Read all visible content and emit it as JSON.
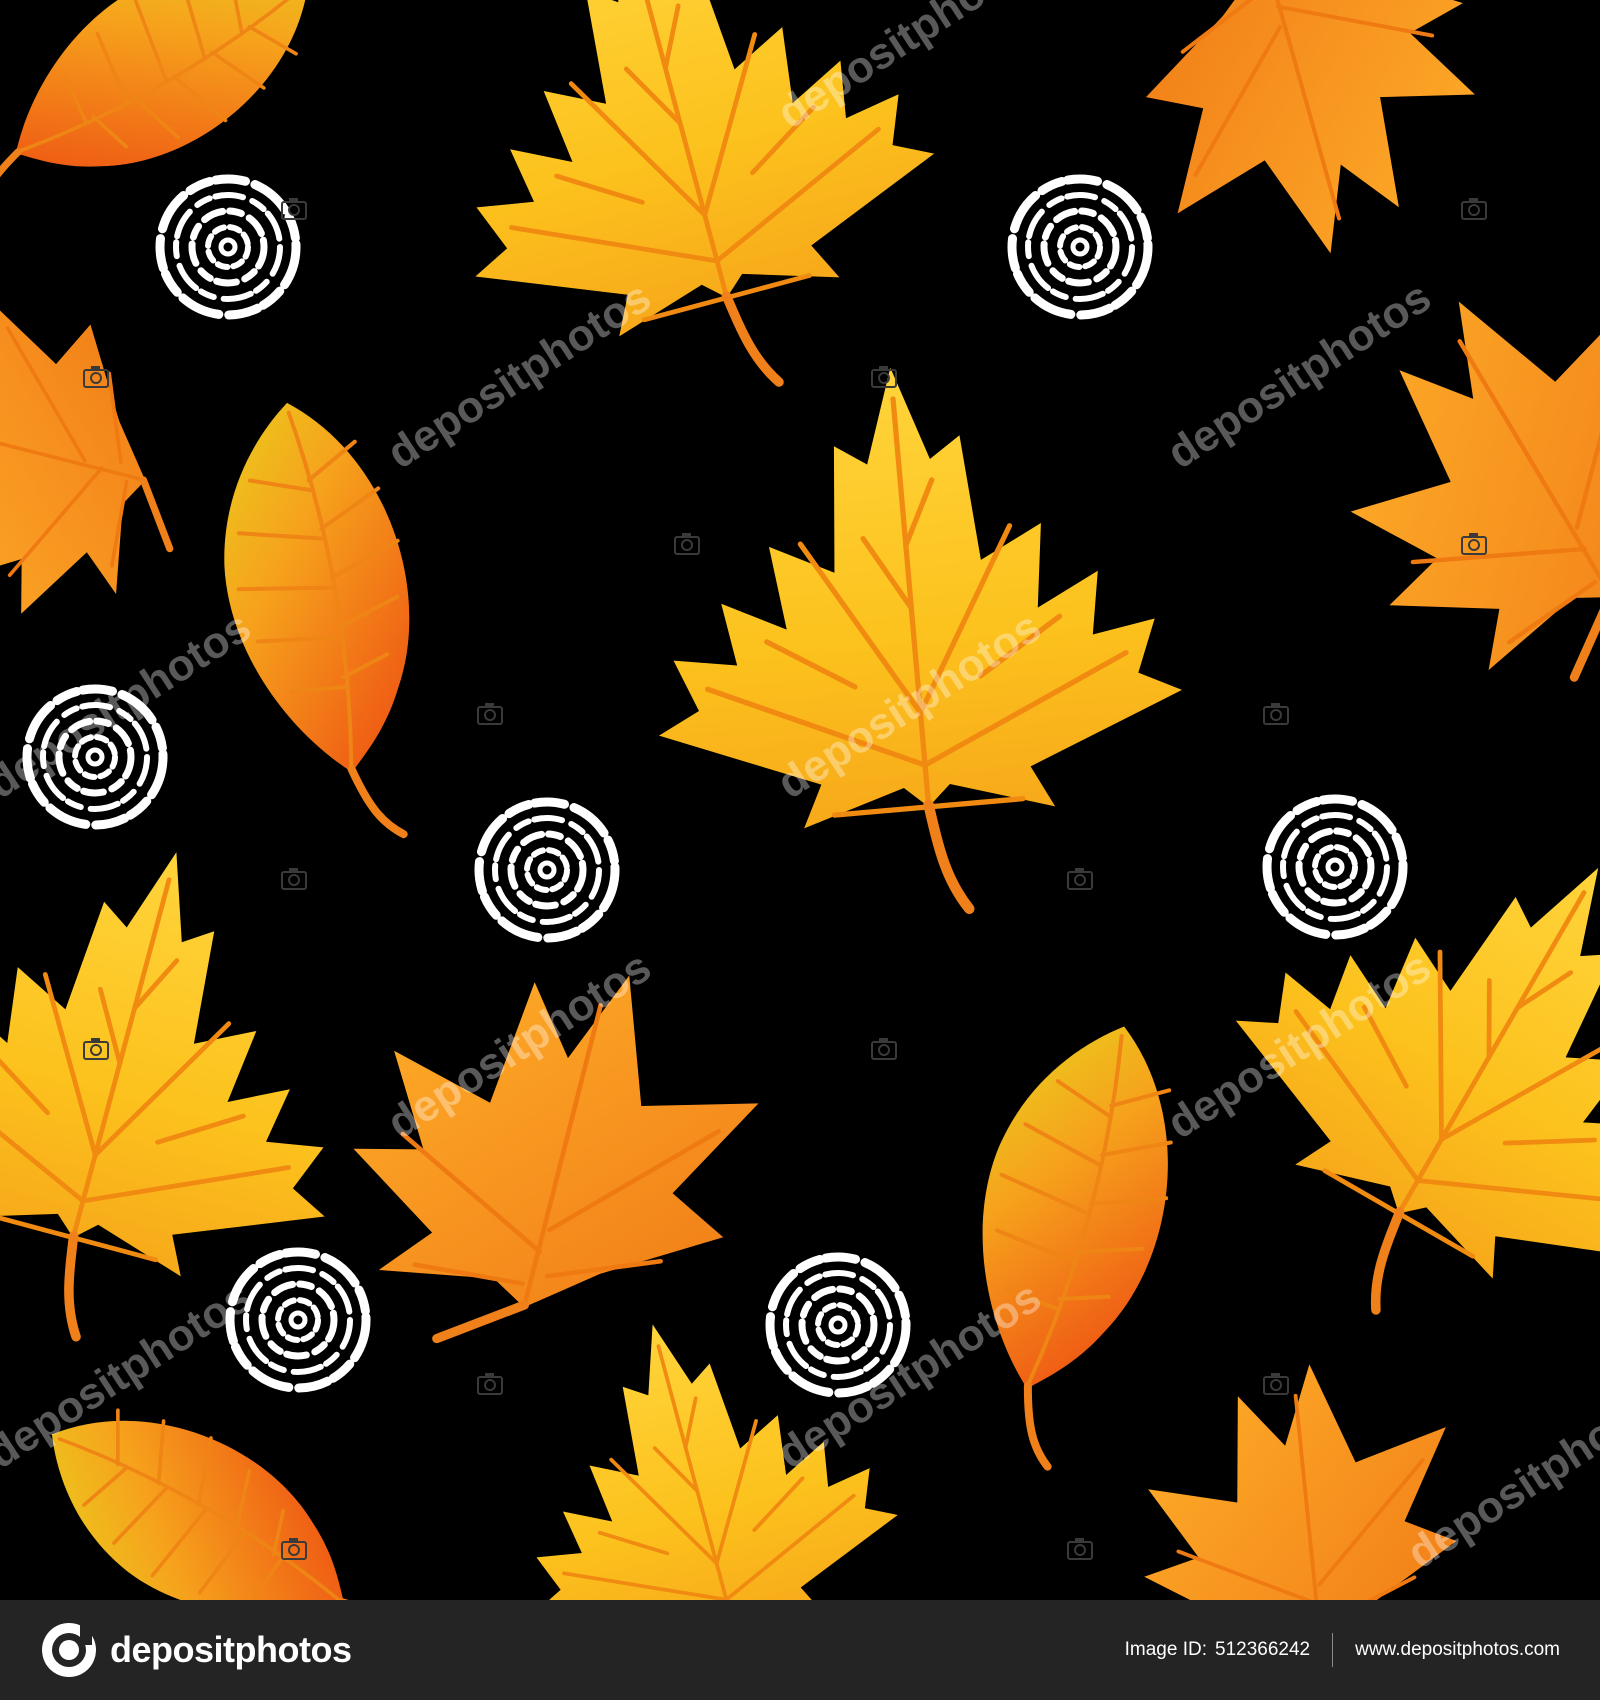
{
  "watermark": {
    "text": "depositphotos"
  },
  "footer": {
    "brand": "depositphotos",
    "image_id_label": "Image ID:",
    "image_id": "512366242",
    "url": "www.depositphotos.com"
  },
  "colors": {
    "background": "#000000",
    "footer": "#242424",
    "maple_yellow": "#fcc21d",
    "leaf_orange": "#f6921e",
    "vein": "#f08a10",
    "swirl": "#ffffff"
  },
  "icons": [
    "logo-icon",
    "camera-icon"
  ]
}
